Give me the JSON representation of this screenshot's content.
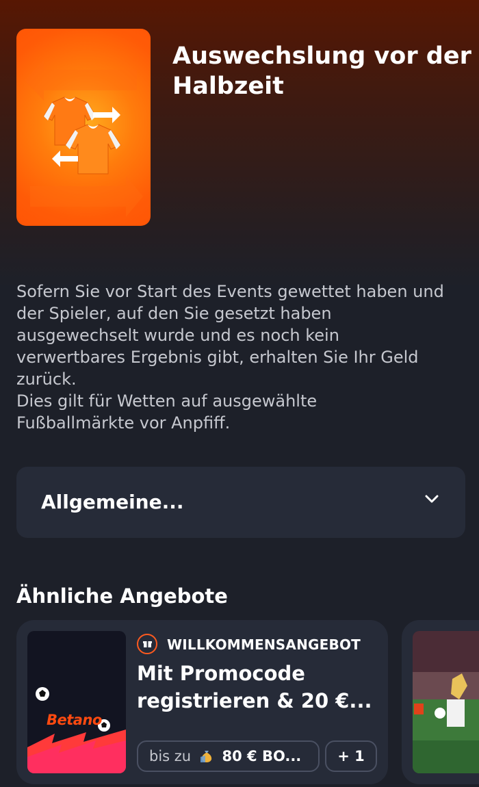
{
  "hero": {
    "title_line1": "Auswechslung vor der",
    "title_line2": "Halbzeit",
    "image_icon": "jersey-swap-icon"
  },
  "description": {
    "paragraph1_lines": [
      "Sofern Sie vor Start des Events gewettet haben und",
      "der Spieler, auf den Sie gesetzt haben",
      "ausgewechselt wurde und es noch kein",
      "verwertbares Ergebnis gibt, erhalten Sie Ihr Geld",
      "zurück."
    ],
    "paragraph2_lines": [
      "Dies gilt für Wetten auf ausgewählte",
      "Fußballmärkte vor Anpfiff."
    ]
  },
  "accordion": {
    "label": "Allgemeine...",
    "icon": "chevron-down-icon"
  },
  "similar": {
    "title": "Ähnliche Angebote",
    "offers": [
      {
        "badge": "WILLKOMMENSANGEBOT",
        "badge_icon": "gift-icon",
        "title_line1": "Mit Promocode",
        "title_line2": "registrieren & 20 €...",
        "thumb_logo": "Betano",
        "bonus_prefix": "bis zu",
        "bonus_icon": "money-bag-icon",
        "bonus_amount": "80 € BO...",
        "more": "+ 1"
      }
    ]
  },
  "colors": {
    "accent": "#ff5a1f",
    "background": "#1d2029",
    "card": "#262b38",
    "header_top": "#571703"
  }
}
